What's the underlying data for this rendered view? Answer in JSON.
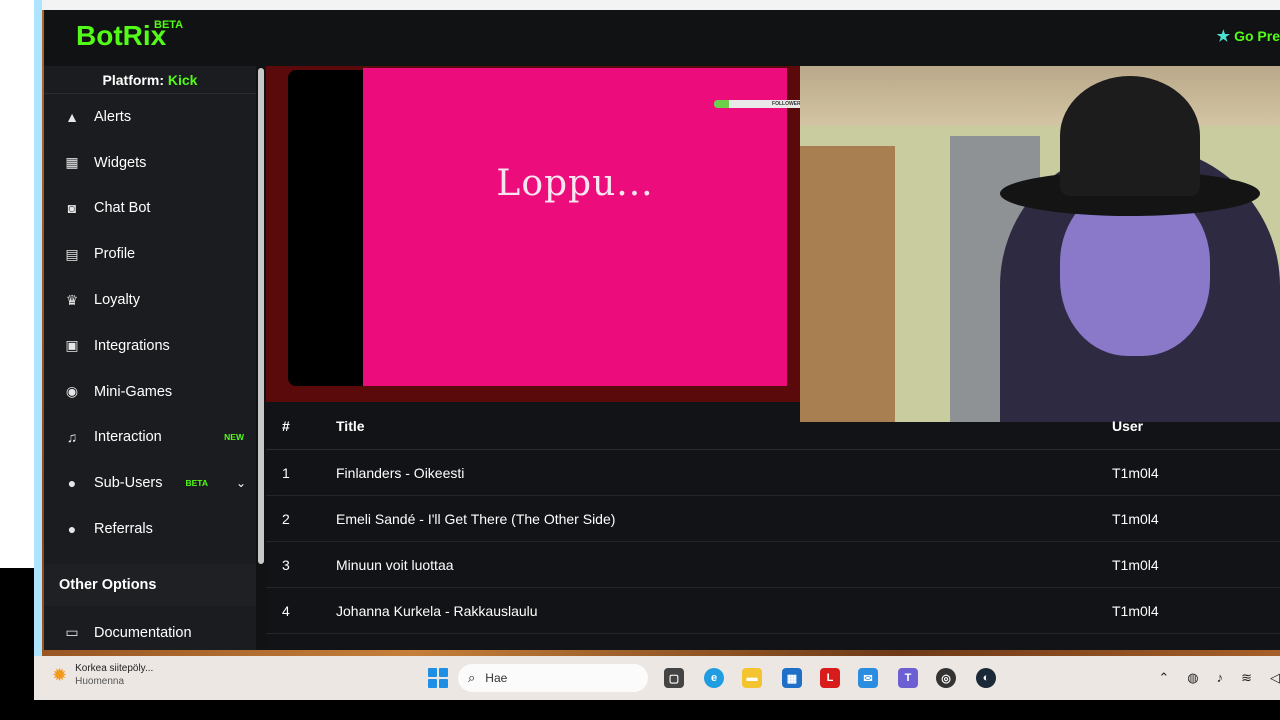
{
  "header": {
    "logo": "BotRix",
    "logo_badge": "BETA",
    "premium_label": "Go Pre"
  },
  "sidebar": {
    "platform_label": "Platform:",
    "platform_value": "Kick",
    "items": [
      {
        "label": "Alerts",
        "icon": "warning-icon"
      },
      {
        "label": "Widgets",
        "icon": "grid-icon"
      },
      {
        "label": "Chat Bot",
        "icon": "robot-icon"
      },
      {
        "label": "Profile",
        "icon": "id-card-icon"
      },
      {
        "label": "Loyalty",
        "icon": "trophy-icon"
      },
      {
        "label": "Integrations",
        "icon": "plug-icon"
      },
      {
        "label": "Mini-Games",
        "icon": "gamepad-icon"
      },
      {
        "label": "Interaction",
        "icon": "music-icon",
        "badge": "NEW"
      },
      {
        "label": "Sub-Users",
        "icon": "users-icon",
        "badge": "BETA"
      },
      {
        "label": "Referrals",
        "icon": "user-group-icon"
      }
    ],
    "other_options": "Other Options",
    "documentation": "Documentation"
  },
  "video": {
    "text": "Loppu...",
    "follower_label": "FOLLOWERS",
    "follower_progress": 0.1
  },
  "table": {
    "headers": [
      "#",
      "Title",
      "User"
    ],
    "rows": [
      {
        "num": "1",
        "title": "Finlanders - Oikeesti",
        "user": "T1m0l4"
      },
      {
        "num": "2",
        "title": "Emeli Sandé - I'll Get There (The Other Side)",
        "user": "T1m0l4"
      },
      {
        "num": "3",
        "title": "Minuun voit luottaa",
        "user": "T1m0l4"
      },
      {
        "num": "4",
        "title": "Johanna Kurkela - Rakkauslaulu",
        "user": "T1m0l4"
      }
    ]
  },
  "taskbar": {
    "weather_title": "Korkea siitepöly...",
    "weather_sub": "Huomenna",
    "search_placeholder": "Hae"
  },
  "colors": {
    "accent": "#53fc18",
    "video_pink": "#ec0c7b",
    "background": "#111214"
  }
}
